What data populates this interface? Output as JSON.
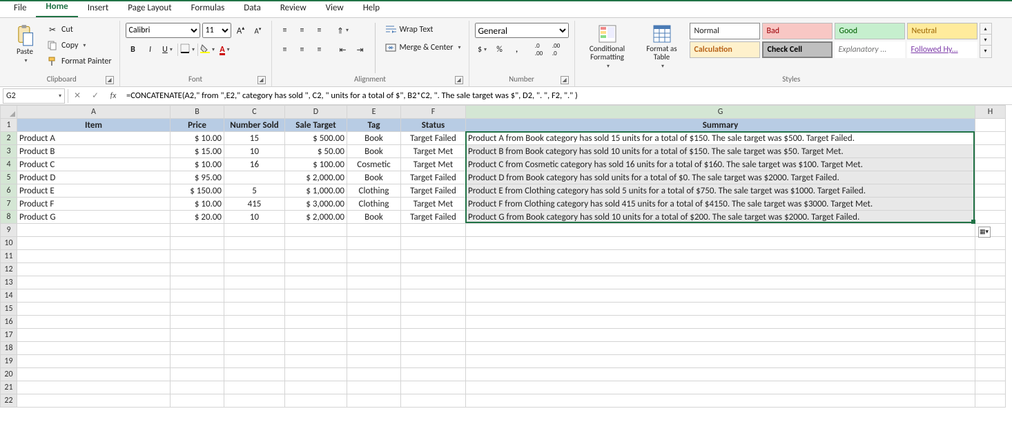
{
  "menu": {
    "items": [
      "File",
      "Home",
      "Insert",
      "Page Layout",
      "Formulas",
      "Data",
      "Review",
      "View",
      "Help"
    ],
    "active": "Home"
  },
  "ribbon": {
    "clipboard": {
      "label": "Clipboard",
      "paste": "Paste",
      "cut": "Cut",
      "copy": "Copy",
      "formatpainter": "Format Painter"
    },
    "font": {
      "label": "Font",
      "name": "Calibri",
      "size": "11"
    },
    "alignment": {
      "label": "Alignment",
      "wrap": "Wrap Text",
      "merge": "Merge & Center"
    },
    "number": {
      "label": "Number",
      "format": "General"
    },
    "styles": {
      "label": "Styles",
      "cond": "Conditional Formatting",
      "table": "Format as Table",
      "chips": {
        "normal": "Normal",
        "bad": "Bad",
        "good": "Good",
        "neutral": "Neutral",
        "calc": "Calculation",
        "check": "Check Cell",
        "expl": "Explanatory ...",
        "hyper": "Followed Hy..."
      }
    }
  },
  "namebox": "G2",
  "formula": "=CONCATENATE(A2,\" from \",E2,\" category has sold \", C2, \" units for a total of $\", B2*C2, \". The sale target was $\", D2, \". \", F2, \".\" )",
  "columns": [
    "A",
    "B",
    "C",
    "D",
    "E",
    "F",
    "G",
    "H"
  ],
  "headers": {
    "A": "Item",
    "B": "Price",
    "C": "Number Sold",
    "D": "Sale Target",
    "E": "Tag",
    "F": "Status",
    "G": "Summary"
  },
  "rows": [
    {
      "A": "Product A",
      "B": "10.00",
      "C": "15",
      "D": "500.00",
      "E": "Book",
      "F": "Target Failed",
      "G": "Product A from Book category has sold 15 units for a total of $150. The sale target was $500. Target Failed."
    },
    {
      "A": "Product B",
      "B": "15.00",
      "C": "10",
      "D": "50.00",
      "E": "Book",
      "F": "Target Met",
      "G": "Product B from Book category has sold 10 units for a total of $150. The sale target was $50. Target Met."
    },
    {
      "A": "Product C",
      "B": "10.00",
      "C": "16",
      "D": "100.00",
      "E": "Cosmetic",
      "F": "Target Met",
      "G": "Product C from Cosmetic category has sold 16 units for a total of $160. The sale target was $100. Target Met."
    },
    {
      "A": "Product D",
      "B": "95.00",
      "C": "",
      "D": "2,000.00",
      "E": "Book",
      "F": "Target Failed",
      "G": "Product D from Book category has sold  units for a total of $0. The sale target was $2000. Target Failed."
    },
    {
      "A": "Product E",
      "B": "150.00",
      "C": "5",
      "D": "1,000.00",
      "E": "Clothing",
      "F": "Target Failed",
      "G": "Product E from Clothing category has sold 5 units for a total of $750. The sale target was $1000. Target Failed."
    },
    {
      "A": "Product F",
      "B": "10.00",
      "C": "415",
      "D": "3,000.00",
      "E": "Clothing",
      "F": "Target Met",
      "G": "Product F from Clothing category has sold 415 units for a total of $4150. The sale target was $3000. Target Met."
    },
    {
      "A": "Product G",
      "B": "20.00",
      "C": "10",
      "D": "2,000.00",
      "E": "Book",
      "F": "Target Failed",
      "G": "Product G from Book category has sold 10 units for a total of $200. The sale target was $2000. Target Failed."
    }
  ],
  "emptyRows": [
    9,
    10,
    11,
    12,
    13,
    14,
    15,
    16,
    17,
    18,
    19,
    20,
    21,
    22
  ]
}
